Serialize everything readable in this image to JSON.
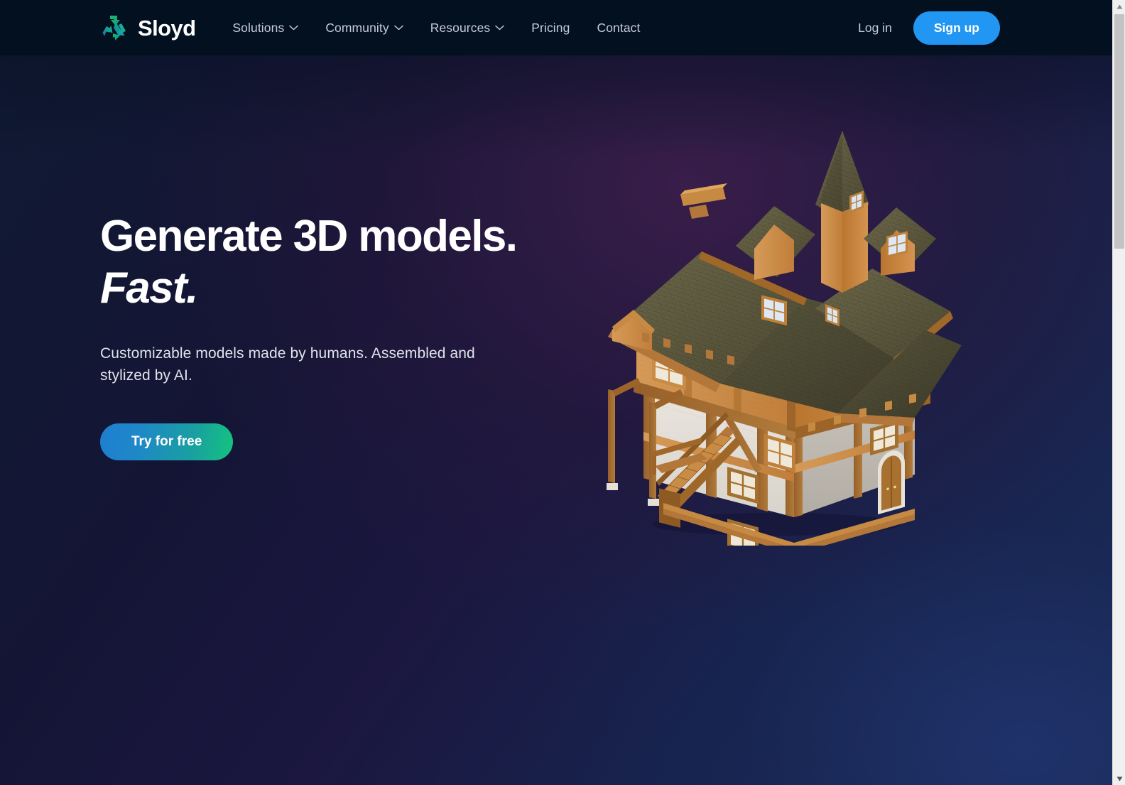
{
  "header": {
    "logo_text": "Sloyd",
    "logo_icon": "sloyd-triangle-arrows-logo",
    "nav": [
      {
        "label": "Solutions",
        "has_dropdown": true
      },
      {
        "label": "Community",
        "has_dropdown": true
      },
      {
        "label": "Resources",
        "has_dropdown": true
      },
      {
        "label": "Pricing",
        "has_dropdown": false
      },
      {
        "label": "Contact",
        "has_dropdown": false
      }
    ],
    "login_label": "Log in",
    "signup_label": "Sign up",
    "bg_color": "#03101f",
    "signup_color": "#2196f3"
  },
  "hero": {
    "headline_line1": "Generate 3D models.",
    "headline_line2": "Fast.",
    "subcopy": "Customizable models made by humans. Assembled and stylized by AI.",
    "cta_label": "Try for free",
    "cta_gradient_from": "#1d7fd0",
    "cta_gradient_to": "#14c47f",
    "model_name": "medieval-half-timbered-house-3d-model",
    "bg_from": "#101a33",
    "bg_to": "#1a2a56"
  },
  "scrollbar": {
    "up_arrow": "scroll-up-arrow",
    "down_arrow": "scroll-down-arrow",
    "thumb": "scroll-thumb"
  }
}
